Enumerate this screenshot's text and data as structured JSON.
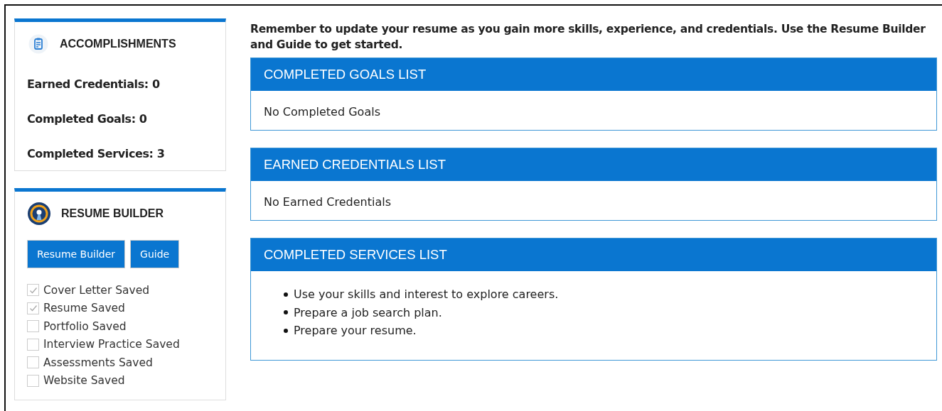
{
  "accomplishments": {
    "title": "ACCOMPLISHMENTS",
    "stats": [
      "Earned Credentials: 0",
      "Completed Goals: 0",
      "Completed Services: 3"
    ]
  },
  "resume_builder": {
    "title": "RESUME BUILDER",
    "buttons": [
      "Resume Builder",
      "Guide"
    ],
    "checklist": [
      {
        "label": "Cover Letter Saved",
        "checked": true
      },
      {
        "label": "Resume Saved",
        "checked": true
      },
      {
        "label": "Portfolio Saved",
        "checked": false
      },
      {
        "label": "Interview Practice Saved",
        "checked": false
      },
      {
        "label": "Assessments Saved",
        "checked": false
      },
      {
        "label": "Website Saved",
        "checked": false
      }
    ]
  },
  "intro": "Remember to update your resume as you gain more skills, experience, and credentials. Use the Resume Builder and Guide to get started.",
  "panels": [
    {
      "title": "COMPLETED GOALS LIST",
      "kind": "text",
      "text": "No Completed Goals"
    },
    {
      "title": "EARNED CREDENTIALS LIST",
      "kind": "text",
      "text": "No Earned Credentials"
    },
    {
      "title": "COMPLETED SERVICES LIST",
      "kind": "list",
      "items": [
        "Use your skills and interest to explore careers.",
        "Prepare a job search plan.",
        "Prepare your resume."
      ]
    }
  ]
}
